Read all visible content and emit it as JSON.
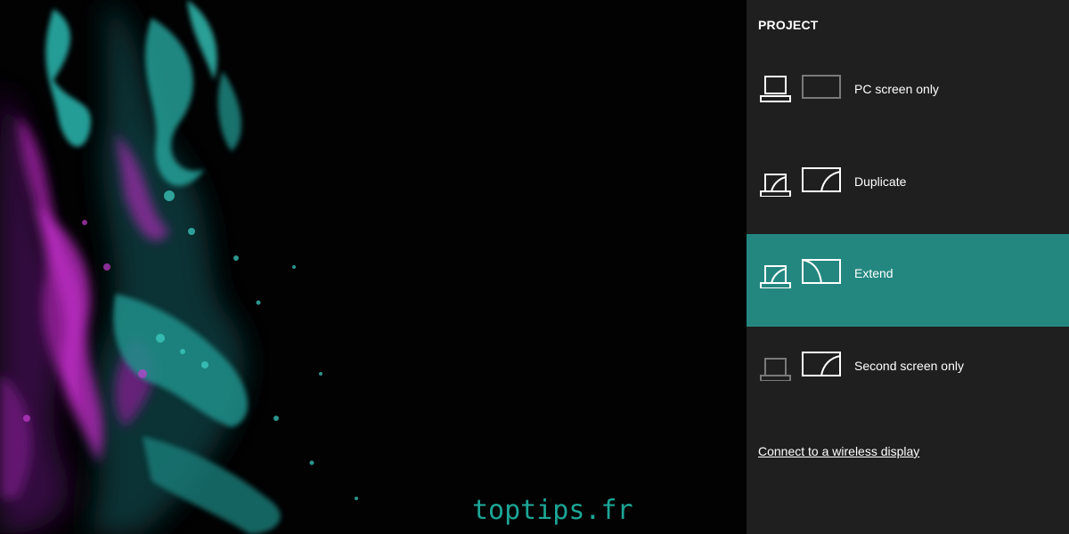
{
  "panel": {
    "title": "PROJECT",
    "selected_color": "#238780",
    "options": [
      {
        "label": "PC screen only",
        "icon": "pc-screen-only-icon",
        "selected": false
      },
      {
        "label": "Duplicate",
        "icon": "duplicate-icon",
        "selected": false
      },
      {
        "label": "Extend",
        "icon": "extend-icon",
        "selected": true
      },
      {
        "label": "Second screen only",
        "icon": "second-screen-only-icon",
        "selected": false
      }
    ],
    "connect_link": "Connect to a wireless display"
  },
  "watermark": "toptips.fr"
}
